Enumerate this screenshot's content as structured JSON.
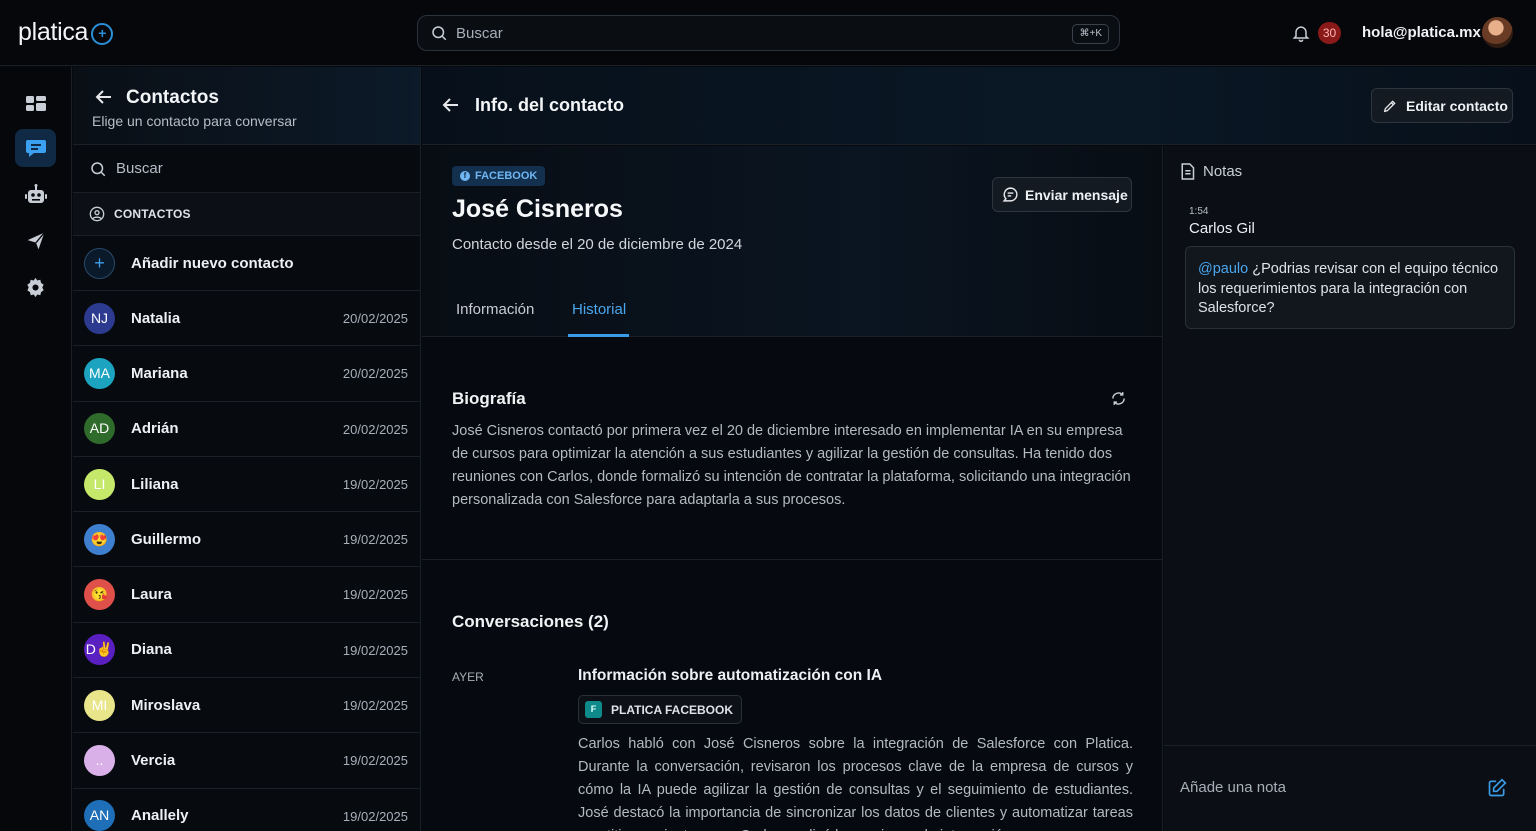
{
  "app": {
    "logo_text": "platica",
    "search_placeholder": "Buscar",
    "shortcut": "⌘+K",
    "notifications_count": "30",
    "user_email": "hola@platica.mx"
  },
  "contacts_panel": {
    "title": "Contactos",
    "subtitle": "Elige un contacto para conversar",
    "search_placeholder": "Buscar",
    "section_label": "CONTACTOS",
    "add_label": "Añadir nuevo contacto",
    "contacts": [
      {
        "initials": "NJ",
        "name": "Natalia",
        "date": "20/02/2025",
        "color": "#2c3a8f"
      },
      {
        "initials": "MA",
        "name": "Mariana",
        "date": "20/02/2025",
        "color": "#1ba3c0"
      },
      {
        "initials": "AD",
        "name": "Adrián",
        "date": "20/02/2025",
        "color": "#2f6b2a"
      },
      {
        "initials": "LI",
        "name": "Liliana",
        "date": "19/02/2025",
        "color": "#c6e86a"
      },
      {
        "initials": "😍",
        "name": "Guillermo",
        "date": "19/02/2025",
        "color": "#3f7fd0"
      },
      {
        "initials": "😘",
        "name": "Laura",
        "date": "19/02/2025",
        "color": "#e0504a"
      },
      {
        "initials": "D✌",
        "name": "Diana",
        "date": "19/02/2025",
        "color": "#5a1fc0"
      },
      {
        "initials": "MI",
        "name": "Miroslava",
        "date": "19/02/2025",
        "color": "#e9e58a"
      },
      {
        "initials": "..",
        "name": "Vercia",
        "date": "19/02/2025",
        "color": "#d9b0e8"
      },
      {
        "initials": "AN",
        "name": "Anallely",
        "date": "19/02/2025",
        "color": "#1e6fb8"
      }
    ]
  },
  "main": {
    "title": "Info. del contacto",
    "edit_label": "Editar contacto"
  },
  "profile": {
    "channel": "FACEBOOK",
    "name": "José Cisneros",
    "since": "Contacto desde el 20 de diciembre de 2024",
    "send_label": "Enviar mensaje",
    "tabs": [
      {
        "label": "Información",
        "active": false
      },
      {
        "label": "Historial",
        "active": true
      }
    ]
  },
  "biography": {
    "title": "Biografía",
    "text": "José Cisneros contactó por primera vez el 20 de diciembre interesado en implementar IA en su empresa de cursos para optimizar la atención a sus estudiantes y agilizar la gestión de consultas. Ha tenido dos reuniones con Carlos, donde formalizó su intención de contratar la plataforma, solicitando una integración personalizada con Salesforce para adaptarla a sus procesos."
  },
  "conversations": {
    "title": "Conversaciones (2)",
    "items": [
      {
        "when": "AYER",
        "title": "Información sobre automatización con IA",
        "channel_icon": "F",
        "channel": "PLATICA FACEBOOK",
        "summary": "Carlos habló con José Cisneros sobre la integración de Salesforce con Platica. Durante la conversación, revisaron los procesos clave de la empresa de cursos y cómo la IA puede agilizar la gestión de consultas y el seguimiento de estudiantes. José destacó la importancia de sincronizar los datos de clientes y automatizar tareas repetitivas, mientras que Carlos explicó las opciones de integración."
      }
    ]
  },
  "notes": {
    "title": "Notas",
    "items": [
      {
        "time": "1:54",
        "author": "Carlos Gil",
        "mention": "@paulo",
        "text": " ¿Podrias revisar con el equipo técnico los requerimientos para la integración con Salesforce?"
      }
    ],
    "input_placeholder": "Añade una nota"
  },
  "colors": {
    "accent": "#3a9be6",
    "badge": "#8a1a1a"
  }
}
